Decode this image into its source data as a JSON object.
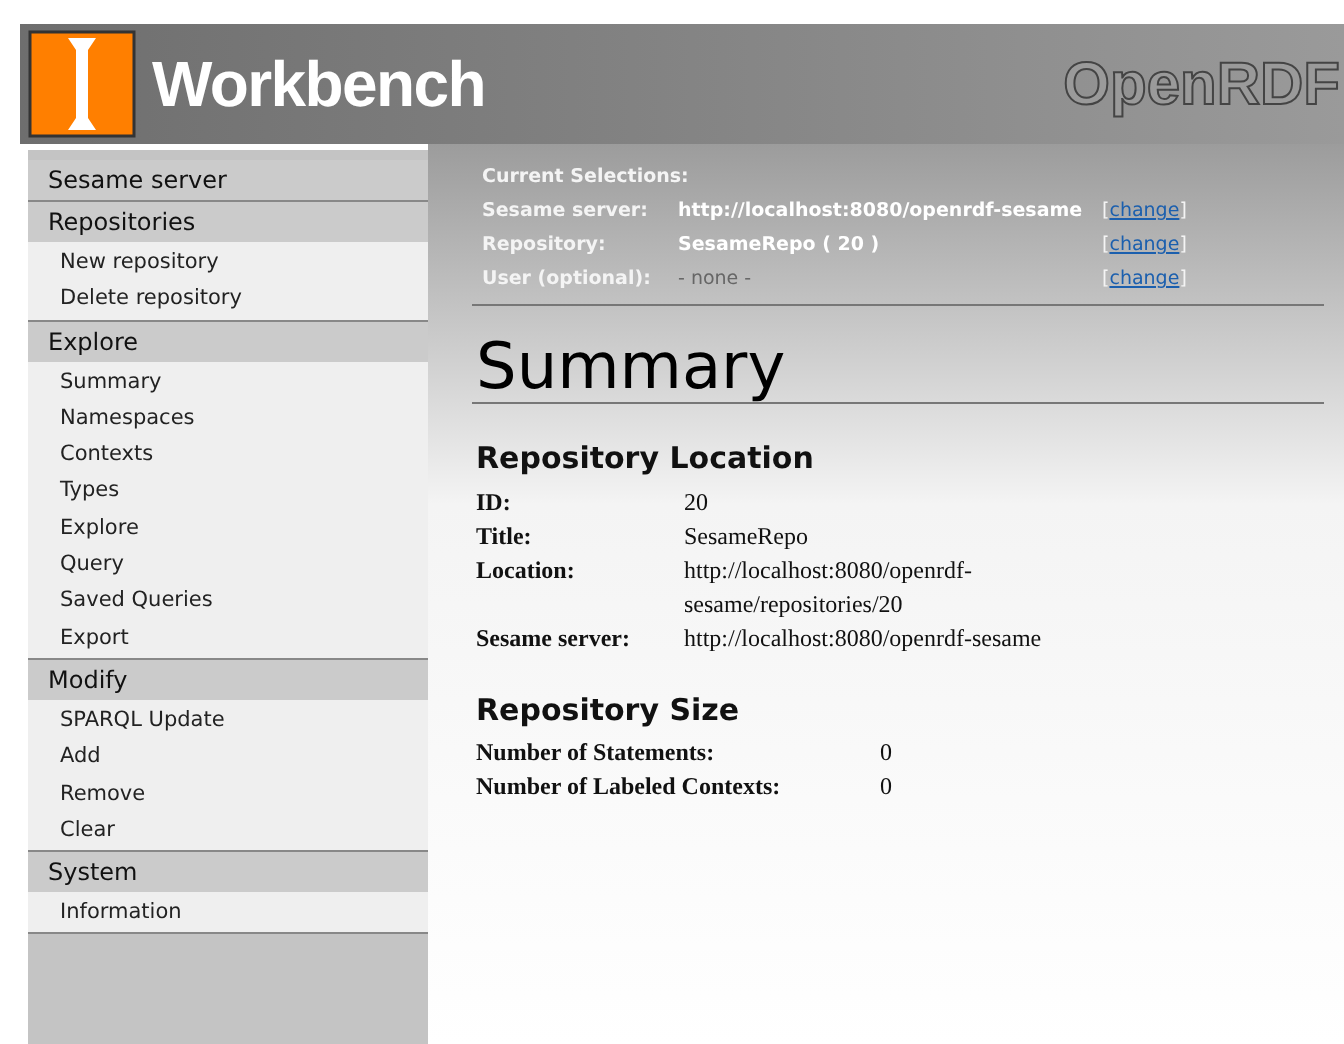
{
  "header": {
    "title": "Workbench",
    "brand": "OpenRDF"
  },
  "sidebar": {
    "sections": [
      {
        "heading": "Sesame server"
      },
      {
        "heading": "Repositories",
        "items": [
          {
            "label": "New repository"
          },
          {
            "label": "Delete repository"
          }
        ]
      },
      {
        "heading": "Explore",
        "items": [
          {
            "label": "Summary"
          },
          {
            "label": "Namespaces"
          },
          {
            "label": "Contexts"
          },
          {
            "label": "Types"
          },
          {
            "label": "Explore"
          },
          {
            "label": "Query"
          },
          {
            "label": "Saved Queries"
          },
          {
            "label": "Export"
          }
        ]
      },
      {
        "heading": "Modify",
        "items": [
          {
            "label": "SPARQL Update"
          },
          {
            "label": "Add"
          },
          {
            "label": "Remove"
          },
          {
            "label": "Clear"
          }
        ]
      },
      {
        "heading": "System",
        "items": [
          {
            "label": "Information"
          }
        ]
      }
    ]
  },
  "selections": {
    "title": "Current Selections:",
    "rows": [
      {
        "label": "Sesame server:",
        "value": "http://localhost:8080/openrdf-sesame",
        "empty": false,
        "open": "[",
        "link": "change",
        "close": "]"
      },
      {
        "label": "Repository:",
        "value": "SesameRepo ( 20 )",
        "empty": false,
        "open": "[",
        "link": "change",
        "close": "]"
      },
      {
        "label": "User (optional):",
        "value": "- none -",
        "empty": true,
        "open": "[",
        "link": "change",
        "close": "]"
      }
    ]
  },
  "page_title": "Summary",
  "sections": [
    {
      "heading": "Repository Location",
      "fields": [
        {
          "label": "ID:",
          "value": "20"
        },
        {
          "label": "Title:",
          "value": "SesameRepo"
        },
        {
          "label": "Location:",
          "value": "http://localhost:8080/openrdf-sesame/repositories/20"
        },
        {
          "label": "Sesame server:",
          "value": "http://localhost:8080/openrdf-sesame"
        }
      ]
    },
    {
      "heading": "Repository Size",
      "fields": [
        {
          "label": "Number of Statements:",
          "value": "0"
        },
        {
          "label": "Number of Labeled Contexts:",
          "value": "0"
        }
      ]
    }
  ]
}
